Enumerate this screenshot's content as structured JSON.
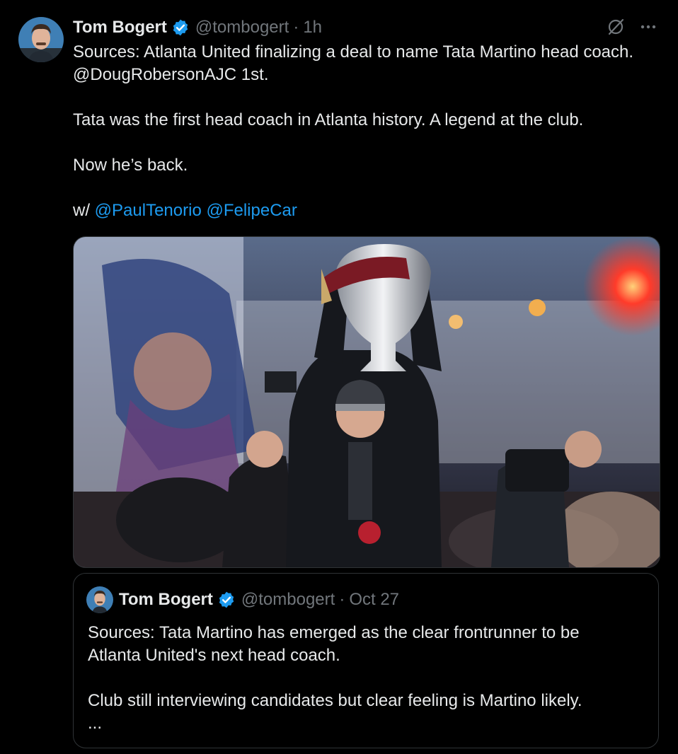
{
  "tweet": {
    "author_name": "Tom Bogert",
    "author_handle": "@tombogert",
    "separator": "·",
    "time": "1h",
    "verified_icon": "verified-badge-icon",
    "grok_icon": "grok-icon",
    "more_icon": "more-icon",
    "lines": [
      "Sources: Atlanta United finalizing a deal to name Tata Martino head coach.",
      "@DougRobersonAJC 1st.",
      "Tata was the first head coach in Atlanta history. A legend at the club.",
      "Now he’s back."
    ],
    "with_prefix": "w/",
    "mentions": [
      "@PaulTenorio",
      "@FelipeCar"
    ],
    "colors": {
      "link": "#1d9bf0",
      "text": "#e7e9ea",
      "muted": "#71767b",
      "verified": "#1d9bf0"
    }
  },
  "quoted": {
    "author_name": "Tom Bogert",
    "author_handle": "@tombogert",
    "separator": "·",
    "date": "Oct 27",
    "lines": [
      "Sources: Tata Martino has emerged as the clear frontrunner to be",
      "Atlanta United's next head coach.",
      "Club still interviewing candidates but clear feeling is Martino likely.",
      "..."
    ]
  }
}
